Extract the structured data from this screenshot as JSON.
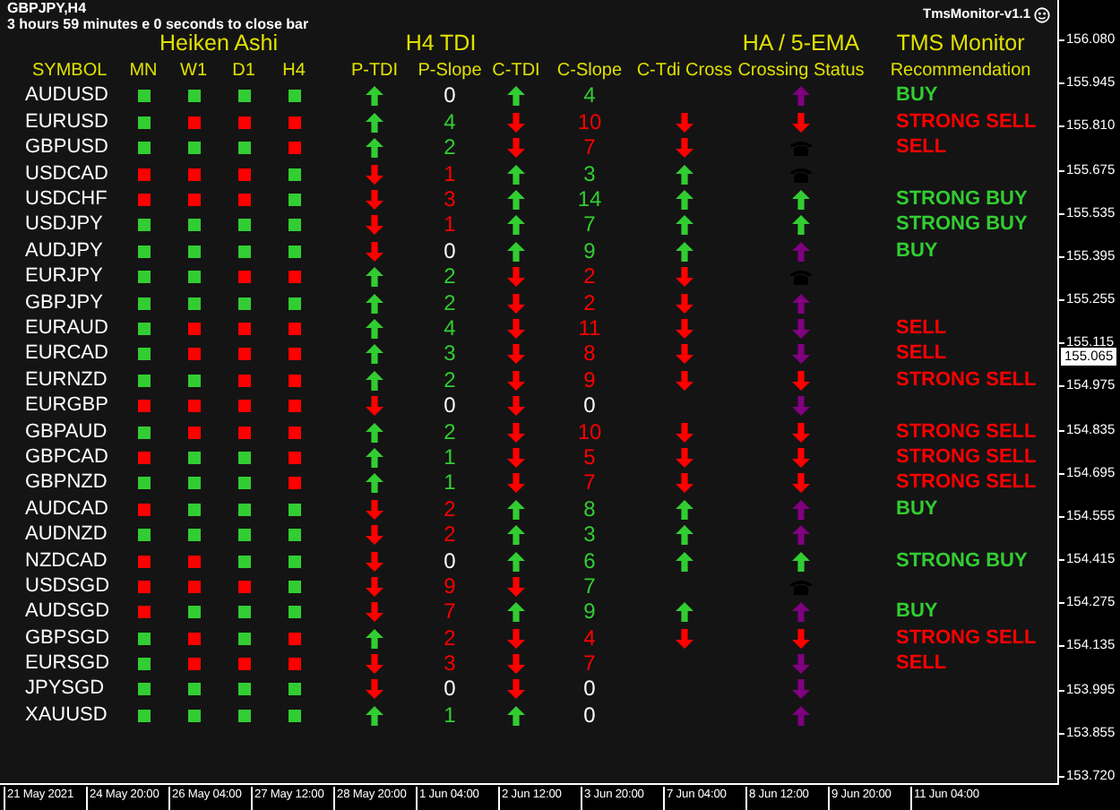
{
  "chart": {
    "symbol_timeframe": "GBPJPY,H4",
    "countdown": "3 hours 59 minutes e 0 seconds to close bar",
    "indicator_label": "TmsMonitor-v1.1"
  },
  "group_headers": [
    "Heiken Ashi",
    "H4 TDI",
    "HA / 5-EMA",
    "TMS Monitor"
  ],
  "columns": [
    "SYMBOL",
    "MN",
    "W1",
    "D1",
    "H4",
    "P-TDI",
    "P-Slope",
    "C-TDI",
    "C-Slope",
    "C-Tdi Cross",
    "Crossing Status",
    "Recommendation"
  ],
  "rows": [
    {
      "symbol": "AUDUSD",
      "heiken_ashi_bullish": [
        true,
        true,
        true,
        true
      ],
      "p_tdi_up": true,
      "p_slope": {
        "text": "0",
        "color": "#ffffff"
      },
      "c_tdi_up": true,
      "c_slope": {
        "text": "4",
        "color": "#32cd32"
      },
      "crossing_status": {
        "kind": "arrow",
        "up": true,
        "color": "#800080"
      },
      "recommendation": {
        "text": "BUY",
        "kind": "buy"
      }
    },
    {
      "symbol": "EURUSD",
      "heiken_ashi_bullish": [
        true,
        false,
        false,
        false
      ],
      "p_tdi_up": true,
      "p_slope": {
        "text": "4",
        "color": "#32cd32"
      },
      "c_tdi_up": false,
      "c_slope": {
        "text": "10",
        "color": "#ff0000"
      },
      "c_tdi_cross_up": false,
      "crossing_status": {
        "kind": "arrow",
        "up": false,
        "color": "#ff0000"
      },
      "recommendation": {
        "text": "STRONG SELL",
        "kind": "sell"
      }
    },
    {
      "symbol": "GBPUSD",
      "heiken_ashi_bullish": [
        true,
        true,
        true,
        false
      ],
      "p_tdi_up": true,
      "p_slope": {
        "text": "2",
        "color": "#32cd32"
      },
      "c_tdi_up": false,
      "c_slope": {
        "text": "7",
        "color": "#ff0000"
      },
      "c_tdi_cross_up": false,
      "crossing_status": {
        "kind": "phone"
      },
      "recommendation": {
        "text": "SELL",
        "kind": "sell"
      }
    },
    {
      "symbol": "USDCAD",
      "heiken_ashi_bullish": [
        false,
        false,
        false,
        true
      ],
      "p_tdi_up": false,
      "p_slope": {
        "text": "1",
        "color": "#ff0000"
      },
      "c_tdi_up": true,
      "c_slope": {
        "text": "3",
        "color": "#32cd32"
      },
      "c_tdi_cross_up": true,
      "crossing_status": {
        "kind": "phone"
      }
    },
    {
      "symbol": "USDCHF",
      "heiken_ashi_bullish": [
        false,
        false,
        false,
        true
      ],
      "p_tdi_up": false,
      "p_slope": {
        "text": "3",
        "color": "#ff0000"
      },
      "c_tdi_up": true,
      "c_slope": {
        "text": "14",
        "color": "#32cd32"
      },
      "c_tdi_cross_up": true,
      "crossing_status": {
        "kind": "arrow",
        "up": true,
        "color": "#32cd32"
      },
      "recommendation": {
        "text": "STRONG BUY",
        "kind": "buy"
      }
    },
    {
      "symbol": "USDJPY",
      "heiken_ashi_bullish": [
        true,
        true,
        true,
        true
      ],
      "p_tdi_up": false,
      "p_slope": {
        "text": "1",
        "color": "#ff0000"
      },
      "c_tdi_up": true,
      "c_slope": {
        "text": "7",
        "color": "#32cd32"
      },
      "c_tdi_cross_up": true,
      "crossing_status": {
        "kind": "arrow",
        "up": true,
        "color": "#32cd32"
      },
      "recommendation": {
        "text": "STRONG BUY",
        "kind": "buy"
      }
    },
    {
      "symbol": "AUDJPY",
      "heiken_ashi_bullish": [
        true,
        true,
        true,
        true
      ],
      "p_tdi_up": false,
      "p_slope": {
        "text": "0",
        "color": "#ffffff"
      },
      "c_tdi_up": true,
      "c_slope": {
        "text": "9",
        "color": "#32cd32"
      },
      "c_tdi_cross_up": true,
      "crossing_status": {
        "kind": "arrow",
        "up": true,
        "color": "#800080"
      },
      "recommendation": {
        "text": "BUY",
        "kind": "buy"
      }
    },
    {
      "symbol": "EURJPY",
      "heiken_ashi_bullish": [
        true,
        true,
        false,
        false
      ],
      "p_tdi_up": true,
      "p_slope": {
        "text": "2",
        "color": "#32cd32"
      },
      "c_tdi_up": false,
      "c_slope": {
        "text": "2",
        "color": "#ff0000"
      },
      "c_tdi_cross_up": false,
      "crossing_status": {
        "kind": "phone"
      }
    },
    {
      "symbol": "GBPJPY",
      "heiken_ashi_bullish": [
        true,
        true,
        true,
        true
      ],
      "p_tdi_up": true,
      "p_slope": {
        "text": "2",
        "color": "#32cd32"
      },
      "c_tdi_up": false,
      "c_slope": {
        "text": "2",
        "color": "#ff0000"
      },
      "c_tdi_cross_up": false,
      "crossing_status": {
        "kind": "arrow",
        "up": true,
        "color": "#800080"
      }
    },
    {
      "symbol": "EURAUD",
      "heiken_ashi_bullish": [
        true,
        false,
        false,
        false
      ],
      "p_tdi_up": true,
      "p_slope": {
        "text": "4",
        "color": "#32cd32"
      },
      "c_tdi_up": false,
      "c_slope": {
        "text": "11",
        "color": "#ff0000"
      },
      "c_tdi_cross_up": false,
      "crossing_status": {
        "kind": "arrow",
        "up": false,
        "color": "#800080"
      },
      "recommendation": {
        "text": "SELL",
        "kind": "sell"
      }
    },
    {
      "symbol": "EURCAD",
      "heiken_ashi_bullish": [
        true,
        false,
        false,
        false
      ],
      "p_tdi_up": true,
      "p_slope": {
        "text": "3",
        "color": "#32cd32"
      },
      "c_tdi_up": false,
      "c_slope": {
        "text": "8",
        "color": "#ff0000"
      },
      "c_tdi_cross_up": false,
      "crossing_status": {
        "kind": "arrow",
        "up": false,
        "color": "#800080"
      },
      "recommendation": {
        "text": "SELL",
        "kind": "sell"
      }
    },
    {
      "symbol": "EURNZD",
      "heiken_ashi_bullish": [
        true,
        true,
        false,
        false
      ],
      "p_tdi_up": true,
      "p_slope": {
        "text": "2",
        "color": "#32cd32"
      },
      "c_tdi_up": false,
      "c_slope": {
        "text": "9",
        "color": "#ff0000"
      },
      "c_tdi_cross_up": false,
      "crossing_status": {
        "kind": "arrow",
        "up": false,
        "color": "#ff0000"
      },
      "recommendation": {
        "text": "STRONG SELL",
        "kind": "sell"
      }
    },
    {
      "symbol": "EURGBP",
      "heiken_ashi_bullish": [
        false,
        false,
        false,
        false
      ],
      "p_tdi_up": false,
      "p_slope": {
        "text": "0",
        "color": "#ffffff"
      },
      "c_tdi_up": false,
      "c_slope": {
        "text": "0",
        "color": "#ffffff"
      },
      "crossing_status": {
        "kind": "arrow",
        "up": false,
        "color": "#800080"
      }
    },
    {
      "symbol": "GBPAUD",
      "heiken_ashi_bullish": [
        true,
        false,
        false,
        false
      ],
      "p_tdi_up": true,
      "p_slope": {
        "text": "2",
        "color": "#32cd32"
      },
      "c_tdi_up": false,
      "c_slope": {
        "text": "10",
        "color": "#ff0000"
      },
      "c_tdi_cross_up": false,
      "crossing_status": {
        "kind": "arrow",
        "up": false,
        "color": "#ff0000"
      },
      "recommendation": {
        "text": "STRONG SELL",
        "kind": "sell"
      }
    },
    {
      "symbol": "GBPCAD",
      "heiken_ashi_bullish": [
        false,
        true,
        true,
        false
      ],
      "p_tdi_up": true,
      "p_slope": {
        "text": "1",
        "color": "#32cd32"
      },
      "c_tdi_up": false,
      "c_slope": {
        "text": "5",
        "color": "#ff0000"
      },
      "c_tdi_cross_up": false,
      "crossing_status": {
        "kind": "arrow",
        "up": false,
        "color": "#ff0000"
      },
      "recommendation": {
        "text": "STRONG SELL",
        "kind": "sell"
      }
    },
    {
      "symbol": "GBPNZD",
      "heiken_ashi_bullish": [
        true,
        true,
        true,
        false
      ],
      "p_tdi_up": true,
      "p_slope": {
        "text": "1",
        "color": "#32cd32"
      },
      "c_tdi_up": false,
      "c_slope": {
        "text": "7",
        "color": "#ff0000"
      },
      "c_tdi_cross_up": false,
      "crossing_status": {
        "kind": "arrow",
        "up": false,
        "color": "#ff0000"
      },
      "recommendation": {
        "text": "STRONG SELL",
        "kind": "sell"
      }
    },
    {
      "symbol": "AUDCAD",
      "heiken_ashi_bullish": [
        false,
        true,
        true,
        true
      ],
      "p_tdi_up": false,
      "p_slope": {
        "text": "2",
        "color": "#ff0000"
      },
      "c_tdi_up": true,
      "c_slope": {
        "text": "8",
        "color": "#32cd32"
      },
      "c_tdi_cross_up": true,
      "crossing_status": {
        "kind": "arrow",
        "up": true,
        "color": "#800080"
      },
      "recommendation": {
        "text": "BUY",
        "kind": "buy"
      }
    },
    {
      "symbol": "AUDNZD",
      "heiken_ashi_bullish": [
        true,
        true,
        true,
        true
      ],
      "p_tdi_up": false,
      "p_slope": {
        "text": "2",
        "color": "#ff0000"
      },
      "c_tdi_up": true,
      "c_slope": {
        "text": "3",
        "color": "#32cd32"
      },
      "c_tdi_cross_up": true,
      "crossing_status": {
        "kind": "arrow",
        "up": true,
        "color": "#800080"
      }
    },
    {
      "symbol": "NZDCAD",
      "heiken_ashi_bullish": [
        false,
        false,
        true,
        true
      ],
      "p_tdi_up": false,
      "p_slope": {
        "text": "0",
        "color": "#ffffff"
      },
      "c_tdi_up": true,
      "c_slope": {
        "text": "6",
        "color": "#32cd32"
      },
      "c_tdi_cross_up": true,
      "crossing_status": {
        "kind": "arrow",
        "up": true,
        "color": "#32cd32"
      },
      "recommendation": {
        "text": "STRONG BUY",
        "kind": "buy"
      }
    },
    {
      "symbol": "USDSGD",
      "heiken_ashi_bullish": [
        false,
        false,
        false,
        true
      ],
      "p_tdi_up": false,
      "p_slope": {
        "text": "9",
        "color": "#ff0000"
      },
      "c_tdi_up": false,
      "c_slope": {
        "text": "7",
        "color": "#32cd32"
      },
      "crossing_status": {
        "kind": "phone"
      }
    },
    {
      "symbol": "AUDSGD",
      "heiken_ashi_bullish": [
        false,
        true,
        true,
        true
      ],
      "p_tdi_up": false,
      "p_slope": {
        "text": "7",
        "color": "#ff0000"
      },
      "c_tdi_up": true,
      "c_slope": {
        "text": "9",
        "color": "#32cd32"
      },
      "c_tdi_cross_up": true,
      "crossing_status": {
        "kind": "arrow",
        "up": true,
        "color": "#800080"
      },
      "recommendation": {
        "text": "BUY",
        "kind": "buy"
      }
    },
    {
      "symbol": "GBPSGD",
      "heiken_ashi_bullish": [
        true,
        false,
        true,
        false
      ],
      "p_tdi_up": true,
      "p_slope": {
        "text": "2",
        "color": "#ff0000"
      },
      "c_tdi_up": false,
      "c_slope": {
        "text": "4",
        "color": "#ff0000"
      },
      "c_tdi_cross_up": false,
      "crossing_status": {
        "kind": "arrow",
        "up": false,
        "color": "#ff0000"
      },
      "recommendation": {
        "text": "STRONG SELL",
        "kind": "sell"
      }
    },
    {
      "symbol": "EURSGD",
      "heiken_ashi_bullish": [
        true,
        false,
        false,
        false
      ],
      "p_tdi_up": false,
      "p_slope": {
        "text": "3",
        "color": "#ff0000"
      },
      "c_tdi_up": false,
      "c_slope": {
        "text": "7",
        "color": "#ff0000"
      },
      "crossing_status": {
        "kind": "arrow",
        "up": false,
        "color": "#800080"
      },
      "recommendation": {
        "text": "SELL",
        "kind": "sell"
      }
    },
    {
      "symbol": "JPYSGD",
      "heiken_ashi_bullish": [
        true,
        true,
        true,
        true
      ],
      "p_tdi_up": false,
      "p_slope": {
        "text": "0",
        "color": "#ffffff"
      },
      "c_tdi_up": false,
      "c_slope": {
        "text": "0",
        "color": "#ffffff"
      },
      "crossing_status": {
        "kind": "arrow",
        "up": false,
        "color": "#800080"
      }
    },
    {
      "symbol": "XAUUSD",
      "heiken_ashi_bullish": [
        true,
        true,
        true,
        true
      ],
      "p_tdi_up": true,
      "p_slope": {
        "text": "1",
        "color": "#32cd32"
      },
      "c_tdi_up": true,
      "c_slope": {
        "text": "0",
        "color": "#ffffff"
      },
      "crossing_status": {
        "kind": "arrow",
        "up": true,
        "color": "#800080"
      }
    }
  ],
  "price_axis": {
    "labels": [
      "156.080",
      "155.945",
      "155.810",
      "155.675",
      "155.535",
      "155.395",
      "155.255",
      "155.115",
      "154.975",
      "154.835",
      "154.695",
      "154.555",
      "154.415",
      "154.275",
      "154.135",
      "153.995",
      "153.855",
      "153.720"
    ],
    "current_price": "155.065"
  },
  "time_axis": [
    "21 May 2021",
    "24 May 20:00",
    "26 May 04:00",
    "27 May 12:00",
    "28 May 20:00",
    "1 Jun 04:00",
    "2 Jun 12:00",
    "3 Jun 20:00",
    "7 Jun 04:00",
    "8 Jun 12:00",
    "9 Jun 20:00",
    "11 Jun 04:00"
  ]
}
